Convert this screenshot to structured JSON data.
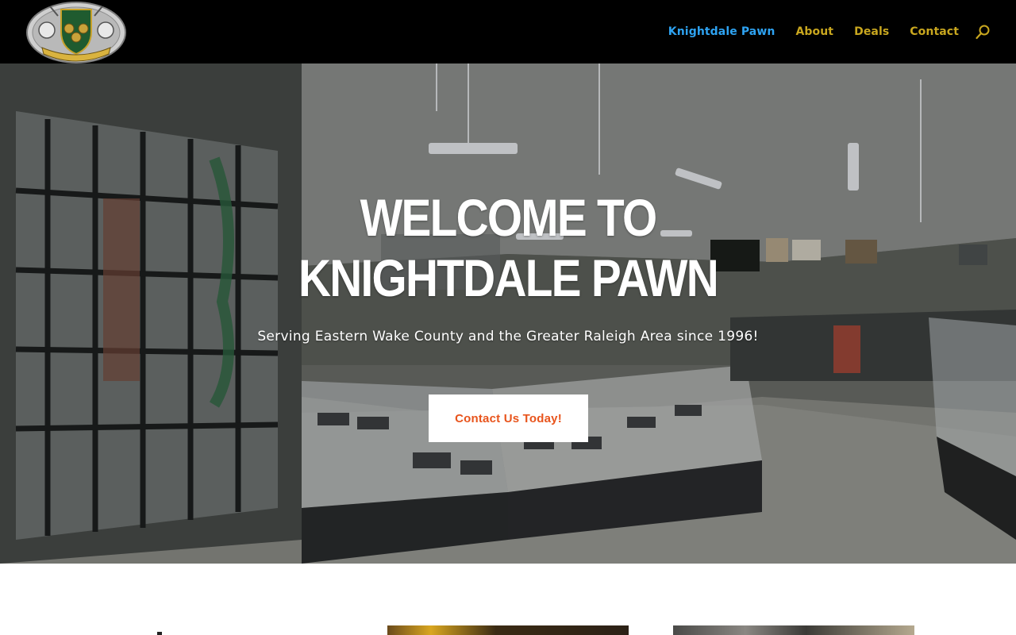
{
  "header": {
    "logo_alt": "Knightdale Pawn logo",
    "logo_text": "Knightdale Pawn",
    "nav": [
      {
        "label": "Knightdale Pawn",
        "active": true
      },
      {
        "label": "About",
        "active": false
      },
      {
        "label": "Deals",
        "active": false
      },
      {
        "label": "Contact",
        "active": false
      }
    ],
    "search_icon": "search-icon"
  },
  "hero": {
    "title_line1": "WELCOME TO",
    "title_line2": "KNIGHTDALE PAWN",
    "subtitle": "Serving Eastern Wake County and the Greater Raleigh Area since 1996!",
    "cta_label": "Contact Us Today!"
  },
  "colors": {
    "header_bg": "#000000",
    "nav_active": "#2ea3f2",
    "nav_link": "#c9a71f",
    "cta_text": "#e8541c",
    "cta_bg": "#ffffff"
  }
}
